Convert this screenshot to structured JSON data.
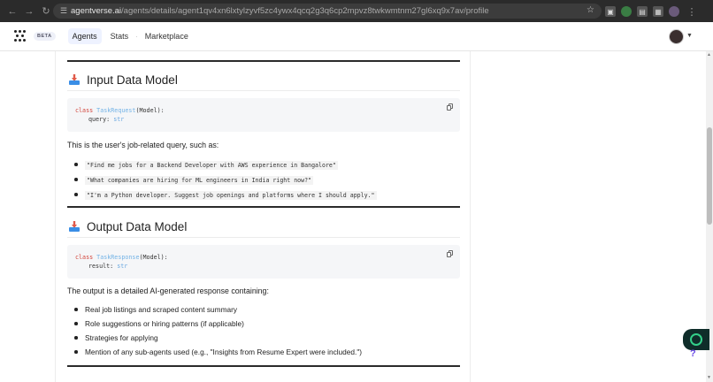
{
  "browser": {
    "url_host": "agentverse.ai",
    "url_path": "/agents/details/agent1qv4xn6lxtylzyvf5zc4ywx4qcq2g3q6cp2mpvz8twkwmtnm27gl6xq9x7av/profile"
  },
  "header": {
    "beta": "BETA",
    "nav": [
      "Agents",
      "Stats",
      "Marketplace"
    ]
  },
  "input_section": {
    "title": "Input Data Model",
    "code_kw": "class",
    "code_class": "TaskRequest",
    "code_rest": "(Model):",
    "code_field": "query:",
    "code_type": "str",
    "description": "This is the user's job-related query, such as:",
    "examples": [
      "\"Find me jobs for a Backend Developer with AWS experience in Bangalore\"",
      "\"What companies are hiring for ML engineers in India right now?\"",
      "\"I'm a Python developer. Suggest job openings and platforms where I should apply.\""
    ]
  },
  "output_section": {
    "title": "Output Data Model",
    "code_kw": "class",
    "code_class": "TaskResponse",
    "code_rest": "(Model):",
    "code_field": "result:",
    "code_type": "str",
    "description": "The output is a detailed AI-generated response containing:",
    "items": [
      "Real job listings and scraped content summary",
      "Role suggestions or hiring patterns (if applicable)",
      "Strategies for applying",
      "Mention of any sub-agents used (e.g., \"Insights from Resume Expert were included.\")"
    ]
  },
  "help": "?"
}
